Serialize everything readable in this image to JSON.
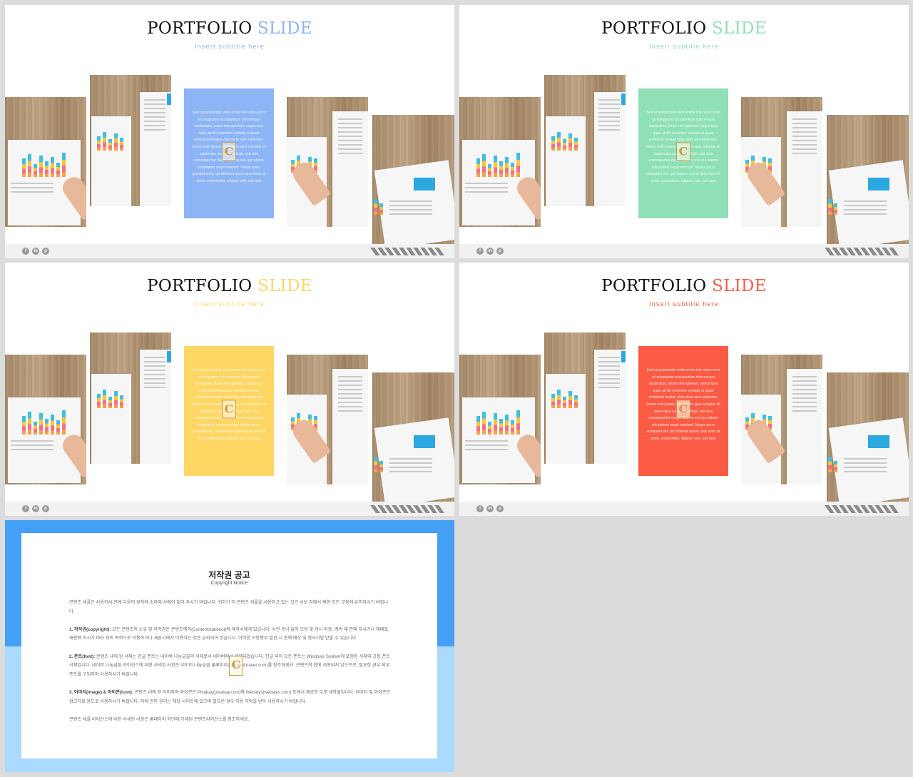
{
  "slides": [
    {
      "title_main": "PORTFOLIO",
      "title_accent": "SLIDE",
      "subtitle": "Insert subtitle here",
      "accent_color": "#8db4f5"
    },
    {
      "title_main": "PORTFOLIO",
      "title_accent": "SLIDE",
      "subtitle": "Insert subtitle here",
      "accent_color": "#8fe0b6"
    },
    {
      "title_main": "PORTFOLIO",
      "title_accent": "SLIDE",
      "subtitle": "Insert subtitle here",
      "accent_color": "#fdd664"
    },
    {
      "title_main": "PORTFOLIO",
      "title_accent": "SLIDE",
      "subtitle": "Insert subtitle here",
      "accent_color": "#fb5b45"
    }
  ],
  "body_text": "Sed ut perspiciatis unde omnis iste natus error sit voluptatem accusantium doloremque laudantium, totam rem aperiam, eaque ipsa quae ab illo inventore veritatis et quasi architecto beatae vitae dicta sunt explicabo. Nemo enim ipsam voluptatem quia voluptas sit aspernatur aut odit aut fugit, sed quia consequuntur magni dolores eos qui ratione voluptatem sequi nesciunt. Neque porro quisquam est, qui dolorem ipsum quia dolor sit amet, consectetur, adipisci velit, sed quia",
  "logo_letter": "C",
  "social_icons": [
    "f",
    "in",
    "p"
  ],
  "notice": {
    "title": "저작권 공고",
    "subtitle": "Copyright Notice",
    "intro": "콘텐츠 세플은 사용하시 전에 다음의 원칙에 소마에 사에이 밑어 추시기 바랍니다. 귀하가 이 콘텐츠 세플을 사용하고 있는 것은 시보 지에서 제한 모든 규정에 유의하시기 바랍니다.",
    "sections": [
      {
        "heading": "1. 저작권(copyright):",
        "text": "모든 콘텐츠의 소유 및 저작권은 콘텐츠에이(Contentstakeout)에 제작시에게 있습니다. 사전 승낙 없이 모방 및 게시 이용, 계속 재 판매 하시거나 재배포, 재판매 하시기 바라 외의 목적으로 이용하거나 재공시에서 이용하는 것은 금지되어 있습니다. 이러한 모방행위 발견 시 손해 배상 및 형사처벌 받을 수 있습니다."
      },
      {
        "heading": "2. 폰트(font):",
        "text": "콘텐츠 내에 된 서체는 한글 폰트는 네이버 나눔글꼴의 서체로서 네이버에서 제작되었습니다. 한글 외의 모든 폰트는 Windows System에 포함된 서체와 공통 폰트 서체입니다. 네이버 나눔글꼴 라이선스에 대한 사세한 사항은 네이버 나눔글꼴 홈페이지(hangeul.naver.com)를 참조하세요. 콘텐츠의 합에 세포되지 않으므로, 필요한 경우 외부 폰트를 구입하여 사용하시기 바랍니다."
      },
      {
        "heading": "3. 이미지(image) & 아이콘(icon):",
        "text": "콘텐츠 내에 된 이미지와 아이콘은 Pixabay(pixabay.com)와 Webalys(webalys.com) 등에서 제공한 무료 세작물입니다. 이미지 및 아이콘은 참고자료 용도로 사용하시기 바랍니다. 이에 관한 권리는 해당 사이트에 있으며 필요한 경우 이용 허락을 받아 사용하시기 바랍니다."
      }
    ],
    "outro": "콘텐츠 세플 라이선스에 대한 사세한 사항은 홈페이지 하단에 기재된 콘텐츠라이선스를 참조하세요."
  }
}
